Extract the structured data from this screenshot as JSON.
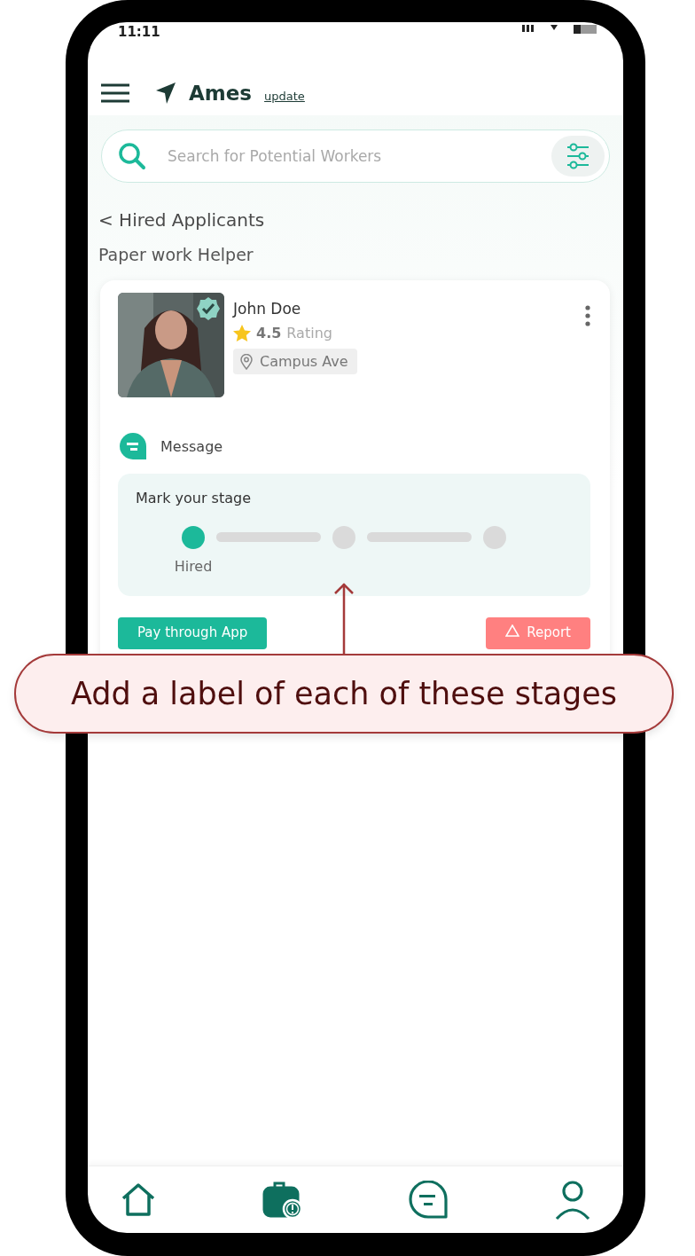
{
  "status_bar": {
    "time": "11:11"
  },
  "header": {
    "location": "Ames",
    "update_link": "update"
  },
  "search": {
    "placeholder": "Search for Potential Workers"
  },
  "breadcrumb": "< Hired Applicants",
  "job_title": "Paper work Helper",
  "applicant": {
    "name": "John Doe",
    "rating": "4.5",
    "rating_label": "Rating",
    "location": "Campus Ave",
    "verified": true
  },
  "message_label": "Message",
  "stage_panel": {
    "title": "Mark your stage",
    "stages": [
      {
        "label": "Hired",
        "reached": true
      },
      {
        "reached": false
      },
      {
        "reached": false
      }
    ]
  },
  "buttons": [
    {
      "kind": "primary",
      "label": "Pay through App"
    },
    {
      "kind": "danger",
      "label": "Report"
    }
  ],
  "bottom_nav": [
    {
      "kind": "home",
      "selected": false
    },
    {
      "kind": "jobs",
      "selected": true
    },
    {
      "kind": "chat",
      "selected": false
    },
    {
      "kind": "profile",
      "selected": false
    }
  ],
  "callout": {
    "text": "Add a label of each of these stages"
  }
}
